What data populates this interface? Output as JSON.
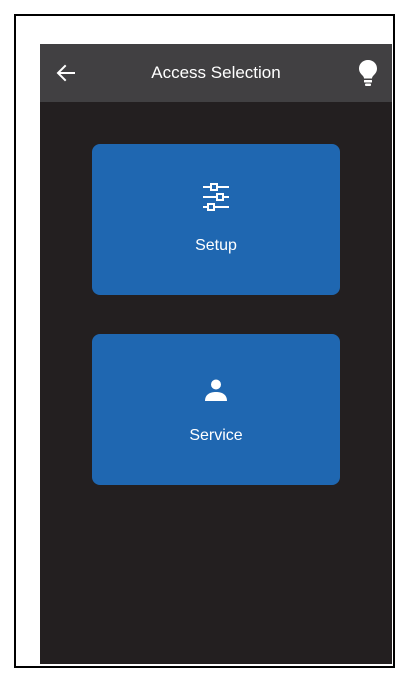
{
  "header": {
    "title": "Access Selection",
    "back_icon": "arrow-left-icon",
    "light_icon": "lightbulb-icon"
  },
  "tiles": [
    {
      "label": "Setup",
      "icon": "sliders-icon"
    },
    {
      "label": "Service",
      "icon": "user-icon"
    }
  ],
  "colors": {
    "background": "#231f20",
    "app_bar": "#414042",
    "tile": "#1f67b1",
    "text": "#ffffff"
  }
}
